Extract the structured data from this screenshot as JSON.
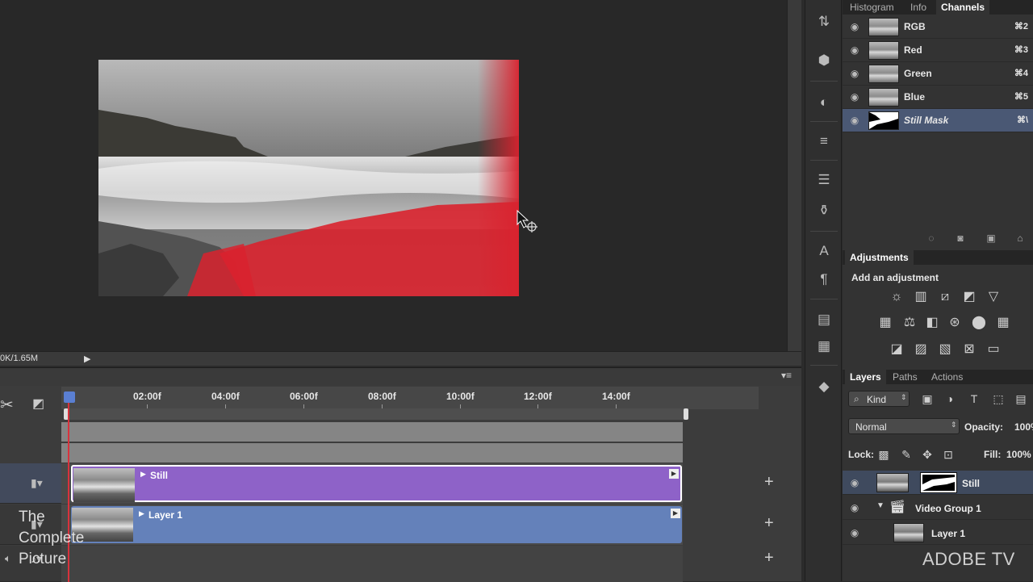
{
  "canvas": {
    "status_text": "0K/1.65M",
    "status_arrow": "▶"
  },
  "channels_panel": {
    "tabs": [
      {
        "label": "Histogram",
        "active": false
      },
      {
        "label": "Info",
        "active": false
      },
      {
        "label": "Channels",
        "active": true
      }
    ],
    "channels": [
      {
        "name": "RGB",
        "shortcut": "⌘2",
        "selected": false
      },
      {
        "name": "Red",
        "shortcut": "⌘3",
        "selected": false
      },
      {
        "name": "Green",
        "shortcut": "⌘4",
        "selected": false
      },
      {
        "name": "Blue",
        "shortcut": "⌘5",
        "selected": false
      },
      {
        "name": "Still Mask",
        "shortcut": "⌘\\",
        "selected": true
      }
    ]
  },
  "adjustments_panel": {
    "tab": "Adjustments",
    "heading": "Add an adjustment"
  },
  "layers_panel": {
    "tabs": [
      {
        "label": "Layers",
        "active": true
      },
      {
        "label": "Paths",
        "active": false
      },
      {
        "label": "Actions",
        "active": false
      }
    ],
    "filter_kind": "Kind",
    "blend_mode": "Normal",
    "opacity_label": "Opacity:",
    "opacity_value": "100%",
    "lock_label": "Lock:",
    "fill_label": "Fill:",
    "fill_value": "100%",
    "layers": [
      {
        "name": "Still",
        "selected": true
      },
      {
        "name": "Video Group 1",
        "selected": false
      },
      {
        "name": "Layer 1",
        "selected": false
      }
    ]
  },
  "timeline": {
    "ruler_labels": [
      "02:00f",
      "04:00f",
      "06:00f",
      "08:00f",
      "10:00f",
      "12:00f",
      "14:00f"
    ],
    "clips": [
      {
        "name": "Still",
        "color": "#8e62c8"
      },
      {
        "name": "Layer 1",
        "color": "#6481ba"
      }
    ]
  },
  "watermark": {
    "left_lines": [
      "The",
      "Complete",
      "Picture"
    ],
    "right": "ADOBE TV"
  },
  "colors": {
    "mask_overlay": "#d9222e",
    "selection_blue": "#4a5874",
    "playhead": "#d8323c"
  }
}
